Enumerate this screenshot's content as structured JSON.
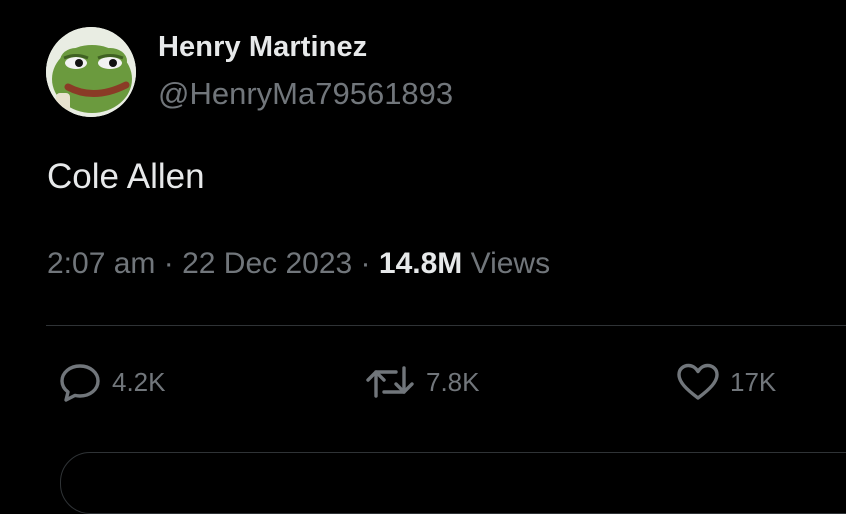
{
  "author": {
    "display_name": "Henry Martinez",
    "handle": "@HenryMa79561893",
    "avatar_icon": "frog-avatar"
  },
  "tweet": {
    "text": "Cole Allen",
    "time": "2:07 am",
    "separator": " · ",
    "date": "22 Dec 2023",
    "views_count": "14.8M",
    "views_label": " Views"
  },
  "actions": {
    "replies": "4.2K",
    "reposts": "7.8K",
    "likes": "17K"
  },
  "colors": {
    "background": "#000000",
    "primary_text": "#e7e9ea",
    "secondary_text": "#71767b",
    "divider": "#2f3336"
  }
}
